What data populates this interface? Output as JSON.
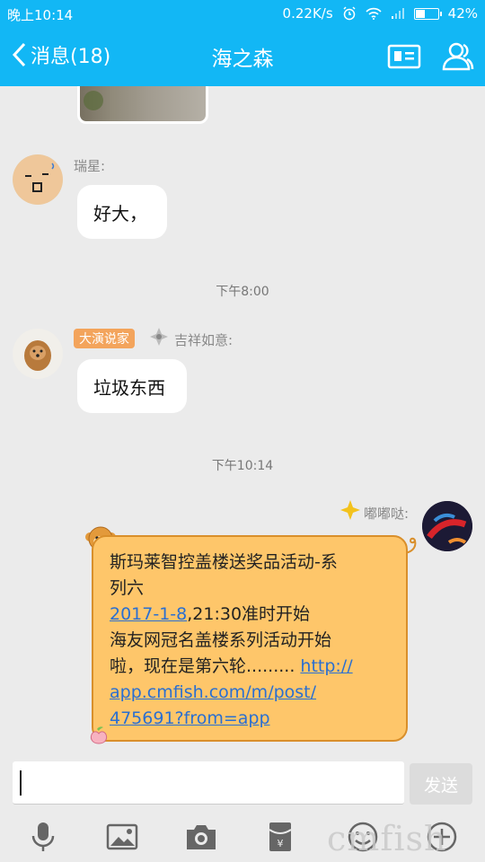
{
  "status": {
    "time": "晚上10:14",
    "speed": "0.22K/s",
    "battery": "42%",
    "battery_level": 0.42
  },
  "nav": {
    "back_label": "消息(18)",
    "title": "海之森"
  },
  "messages": {
    "m1": {
      "sender": "瑞星:",
      "text": "好大，"
    },
    "sep1": "下午8:00",
    "m2": {
      "badge": "大演说家",
      "sender": "吉祥如意:",
      "text": "垃圾东西"
    },
    "sep2": "下午10:14",
    "m3": {
      "sender": "嘟嘟哒:",
      "line1": "斯玛莱智控盖楼送奖品活动-系",
      "line2": "列六",
      "date_link": "2017-1-8",
      "line3_rest": ",21:30准时开始",
      "line4": "海友网冠名盖楼系列活动开始",
      "line5_prefix": "啦，现在是第六轮.........",
      "url_part1": "http://",
      "url_part2": "app.cmfish.com/m/post/",
      "url_part3": "475691?from=app"
    }
  },
  "input": {
    "value": "",
    "send_label": "发送"
  },
  "watermark": "cmfish"
}
